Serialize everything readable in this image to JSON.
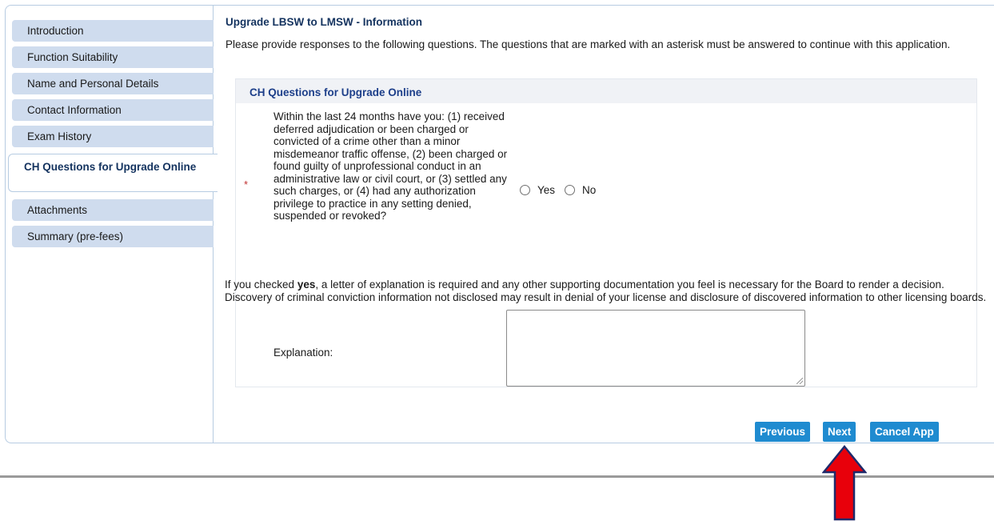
{
  "sidebar": {
    "items": [
      {
        "label": "Introduction"
      },
      {
        "label": "Function Suitability"
      },
      {
        "label": "Name and Personal Details"
      },
      {
        "label": "Contact Information"
      },
      {
        "label": "Exam History"
      },
      {
        "label": "CH Questions for Upgrade Online",
        "active": true
      },
      {
        "label": "Attachments"
      },
      {
        "label": "Summary (pre-fees)"
      }
    ]
  },
  "main": {
    "title": "Upgrade LBSW to LMSW - Information",
    "intro": "Please provide responses to the following questions. The questions that are marked with an asterisk must be answered to continue with this application.",
    "panel": {
      "header": "CH Questions for Upgrade Online",
      "required_marker": "*",
      "question": "Within the last 24 months have you: (1) received deferred adjudication or been charged or convicted of a crime other than a minor misdemeanor traffic offense, (2) been charged or found guilty of unprofessional conduct in an administrative law or civil court, or (3) settled any such charges, or (4) had any authorization privilege to practice in any setting denied, suspended or revoked?",
      "options": [
        "Yes",
        "No"
      ],
      "note_prefix": "If you checked ",
      "note_bold": "yes",
      "note_suffix": ", a letter of explanation is required and any other supporting documentation you feel is necessary for the Board to render a decision. Discovery of criminal conviction information not disclosed may result in denial of your license and disclosure of discovered information to other licensing boards.",
      "explanation_label": "Explanation:",
      "explanation_value": ""
    }
  },
  "buttons": {
    "previous": "Previous",
    "next": "Next",
    "cancel": "Cancel App"
  },
  "colors": {
    "button": "#1f8bd0",
    "nav_bg": "#cfdcee",
    "arrow_fill": "#e8000b",
    "arrow_stroke": "#1f2a6b"
  }
}
